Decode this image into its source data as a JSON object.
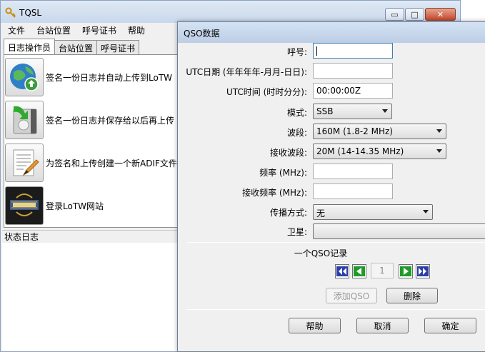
{
  "app": {
    "title": "TQSL"
  },
  "menu": [
    "文件",
    "台站位置",
    "呼号证书",
    "帮助"
  ],
  "tabs": [
    {
      "label": "日志操作员",
      "active": true
    },
    {
      "label": "台站位置",
      "active": false
    },
    {
      "label": "呼号证书",
      "active": false
    }
  ],
  "actions": [
    {
      "label": "签名一份日志并自动上传到LoTW",
      "icon": "globe-upload-icon"
    },
    {
      "label": "签名一份日志并保存给以后再上传",
      "icon": "save-disk-icon"
    },
    {
      "label": "为签名和上传创建一个新ADIF文件",
      "icon": "edit-document-icon"
    },
    {
      "label": "登录LoTW网站",
      "icon": "logbook-logo-icon"
    }
  ],
  "status_log": {
    "label": "状态日志"
  },
  "dialog": {
    "title": "QSO数据",
    "fields": {
      "callsign": {
        "label": "呼号:",
        "value": ""
      },
      "utc_date": {
        "label": "UTC日期 (年年年年-月月-日日):",
        "value": ""
      },
      "utc_time": {
        "label": "UTC时间 (时时分分):",
        "value": "00:00:00Z"
      },
      "mode": {
        "label": "模式:",
        "value": "SSB"
      },
      "band": {
        "label": "波段:",
        "value": "160M (1.8-2 MHz)"
      },
      "rx_band": {
        "label": "接收波段:",
        "value": "20M (14-14.35 MHz)"
      },
      "freq": {
        "label": "频率 (MHz):",
        "value": ""
      },
      "rx_freq": {
        "label": "接收频率 (MHz):",
        "value": ""
      },
      "prop_mode": {
        "label": "传播方式:",
        "value": "无"
      },
      "satellite": {
        "label": "卫星:",
        "value": ""
      }
    },
    "record_count_label": "一个QSO记录",
    "record_index": "1",
    "add_qso_label": "添加QSO",
    "delete_label": "删除",
    "help_label": "帮助",
    "cancel_label": "取消",
    "ok_label": "确定"
  },
  "colors": {
    "nav_green": "#1e9a2a",
    "nav_blue": "#2b3ea8",
    "title_bar": "#c9d8ec"
  }
}
